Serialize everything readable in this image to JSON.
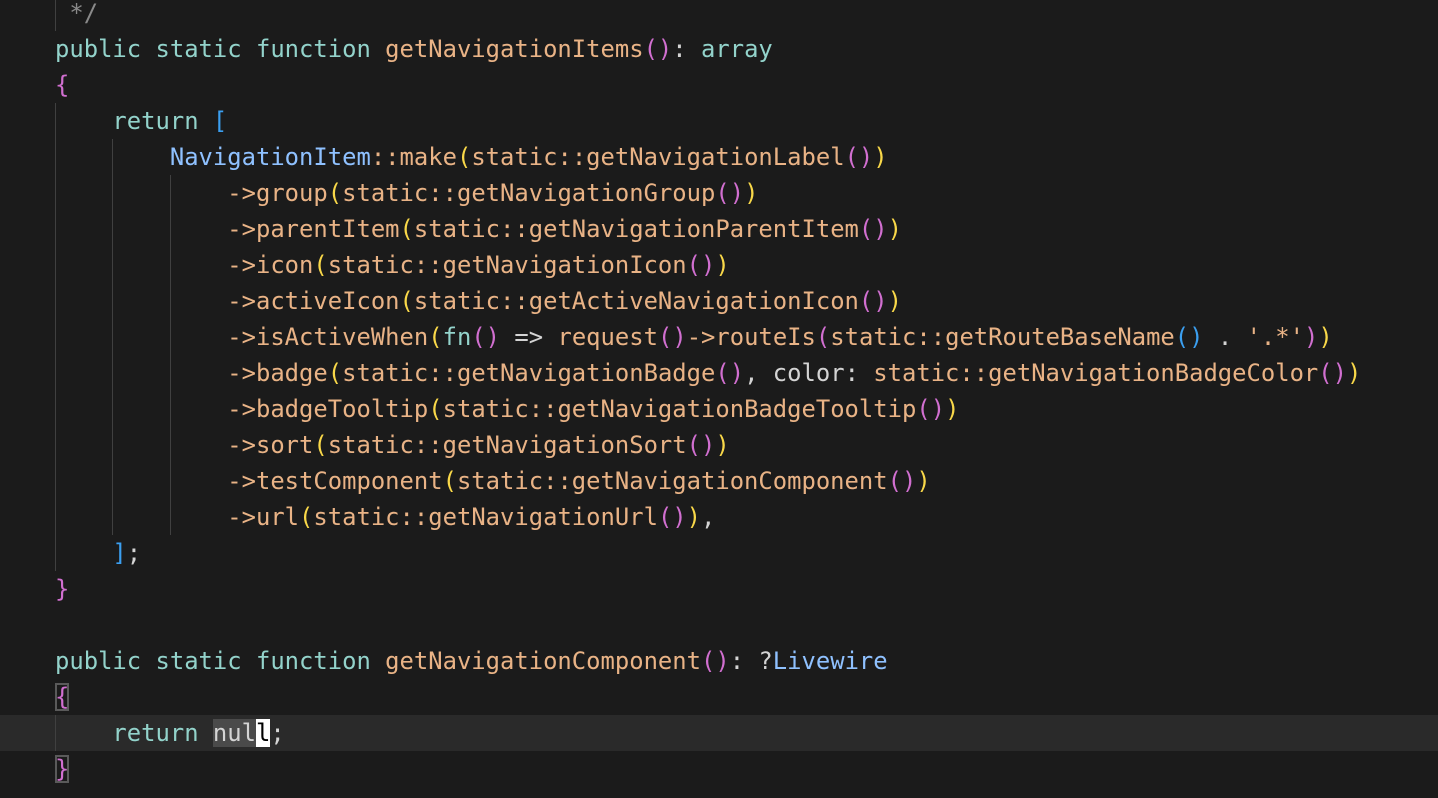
{
  "editor": {
    "language": "php",
    "current_line": 20,
    "lines": [
      [
        [
          "pl",
          " "
        ],
        [
          "cm",
          "*/"
        ]
      ],
      [
        [
          "kw",
          "public static function "
        ],
        [
          "fn",
          "getNavigationItems"
        ],
        [
          "b2",
          "()"
        ],
        [
          "pl",
          ": "
        ],
        [
          "kw",
          "array"
        ]
      ],
      [
        [
          "b2",
          "{"
        ]
      ],
      [
        [
          "pl",
          "    "
        ],
        [
          "kw",
          "return "
        ],
        [
          "b3",
          "["
        ]
      ],
      [
        [
          "pl",
          "        "
        ],
        [
          "cls",
          "NavigationItem"
        ],
        [
          "fn",
          "::make"
        ],
        [
          "b1",
          "("
        ],
        [
          "fn",
          "static::getNavigationLabel"
        ],
        [
          "b2",
          "()"
        ],
        [
          "b1",
          ")"
        ]
      ],
      [
        [
          "pl",
          "            "
        ],
        [
          "fn",
          "->group"
        ],
        [
          "b1",
          "("
        ],
        [
          "fn",
          "static::getNavigationGroup"
        ],
        [
          "b2",
          "()"
        ],
        [
          "b1",
          ")"
        ]
      ],
      [
        [
          "pl",
          "            "
        ],
        [
          "fn",
          "->parentItem"
        ],
        [
          "b1",
          "("
        ],
        [
          "fn",
          "static::getNavigationParentItem"
        ],
        [
          "b2",
          "()"
        ],
        [
          "b1",
          ")"
        ]
      ],
      [
        [
          "pl",
          "            "
        ],
        [
          "fn",
          "->icon"
        ],
        [
          "b1",
          "("
        ],
        [
          "fn",
          "static::getNavigationIcon"
        ],
        [
          "b2",
          "()"
        ],
        [
          "b1",
          ")"
        ]
      ],
      [
        [
          "pl",
          "            "
        ],
        [
          "fn",
          "->activeIcon"
        ],
        [
          "b1",
          "("
        ],
        [
          "fn",
          "static::getActiveNavigationIcon"
        ],
        [
          "b2",
          "()"
        ],
        [
          "b1",
          ")"
        ]
      ],
      [
        [
          "pl",
          "            "
        ],
        [
          "fn",
          "->isActiveWhen"
        ],
        [
          "b1",
          "("
        ],
        [
          "kw",
          "fn"
        ],
        [
          "b2",
          "()"
        ],
        [
          "pl",
          " => "
        ],
        [
          "fn",
          "request"
        ],
        [
          "b2",
          "()"
        ],
        [
          "fn",
          "->routeIs"
        ],
        [
          "b2",
          "("
        ],
        [
          "fn",
          "static::getRouteBaseName"
        ],
        [
          "b3",
          "()"
        ],
        [
          "pl",
          " . "
        ],
        [
          "str",
          "'.*'"
        ],
        [
          "b2",
          ")"
        ],
        [
          "b1",
          ")"
        ]
      ],
      [
        [
          "pl",
          "            "
        ],
        [
          "fn",
          "->badge"
        ],
        [
          "b1",
          "("
        ],
        [
          "fn",
          "static::getNavigationBadge"
        ],
        [
          "b2",
          "()"
        ],
        [
          "pl",
          ", color: "
        ],
        [
          "fn",
          "static::getNavigationBadgeColor"
        ],
        [
          "b2",
          "()"
        ],
        [
          "b1",
          ")"
        ]
      ],
      [
        [
          "pl",
          "            "
        ],
        [
          "fn",
          "->badgeTooltip"
        ],
        [
          "b1",
          "("
        ],
        [
          "fn",
          "static::getNavigationBadgeTooltip"
        ],
        [
          "b2",
          "()"
        ],
        [
          "b1",
          ")"
        ]
      ],
      [
        [
          "pl",
          "            "
        ],
        [
          "fn",
          "->sort"
        ],
        [
          "b1",
          "("
        ],
        [
          "fn",
          "static::getNavigationSort"
        ],
        [
          "b2",
          "()"
        ],
        [
          "b1",
          ")"
        ]
      ],
      [
        [
          "pl",
          "            "
        ],
        [
          "fn",
          "->testComponent"
        ],
        [
          "b1",
          "("
        ],
        [
          "fn",
          "static::getNavigationComponent"
        ],
        [
          "b2",
          "()"
        ],
        [
          "b1",
          ")"
        ]
      ],
      [
        [
          "pl",
          "            "
        ],
        [
          "fn",
          "->url"
        ],
        [
          "b1",
          "("
        ],
        [
          "fn",
          "static::getNavigationUrl"
        ],
        [
          "b2",
          "()"
        ],
        [
          "b1",
          ")"
        ],
        [
          "pl",
          ","
        ]
      ],
      [
        [
          "pl",
          "    "
        ],
        [
          "b3",
          "]"
        ],
        [
          "pl",
          ";"
        ]
      ],
      [
        [
          "b2",
          "}"
        ]
      ],
      [],
      [
        [
          "kw",
          "public static function "
        ],
        [
          "fn",
          "getNavigationComponent"
        ],
        [
          "b2",
          "()"
        ],
        [
          "pl",
          ": ?"
        ],
        [
          "cls",
          "Livewire"
        ]
      ],
      [
        [
          "b2 bm",
          "{"
        ]
      ],
      [
        [
          "pl",
          "    "
        ],
        [
          "kw",
          "return "
        ],
        [
          "pl sel",
          "nul"
        ],
        [
          "pl cursor",
          "l"
        ],
        [
          "pl",
          ";"
        ]
      ],
      [
        [
          "b2 bm",
          "}"
        ]
      ]
    ]
  }
}
